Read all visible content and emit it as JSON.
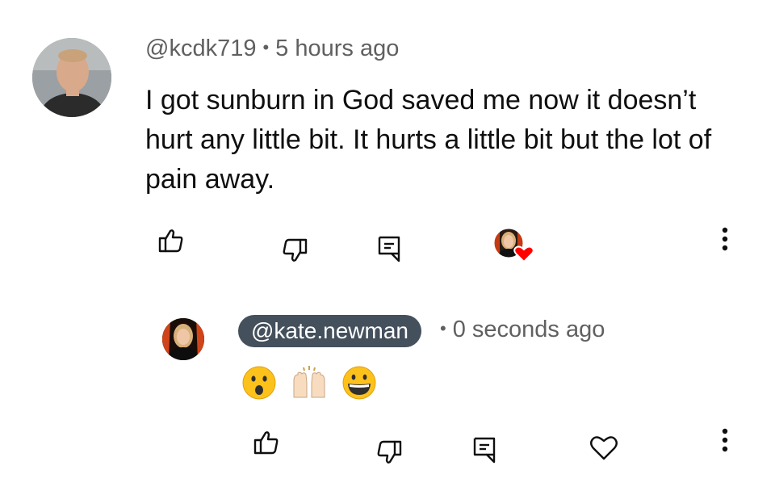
{
  "comment": {
    "author": "@kcdk719",
    "separator": "•",
    "time": "5 hours ago",
    "text": "I got sunburn in God saved me now it doesn’t hurt any little bit. It hurts a little bit but the lot of pain away.",
    "actions": {
      "like_icon": "thumbs-up-icon",
      "dislike_icon": "thumbs-down-icon",
      "reply_icon": "reply-comment-icon",
      "creator_heart": "creator-heart-badge",
      "more_icon": "more-vertical-icon"
    }
  },
  "reply": {
    "author": "@kate.newman",
    "separator": "•",
    "time": "0 seconds ago",
    "emoji": [
      "😮",
      "🙌🏻",
      "😄"
    ],
    "actions": {
      "like_icon": "thumbs-up-icon",
      "dislike_icon": "thumbs-down-icon",
      "reply_icon": "reply-comment-icon",
      "heart_icon": "heart-outline-icon",
      "more_icon": "more-vertical-icon"
    }
  },
  "colors": {
    "text": "#0f0f0f",
    "meta": "#606060",
    "author_pill_bg": "#44505c",
    "heart_red": "#ff0000"
  }
}
